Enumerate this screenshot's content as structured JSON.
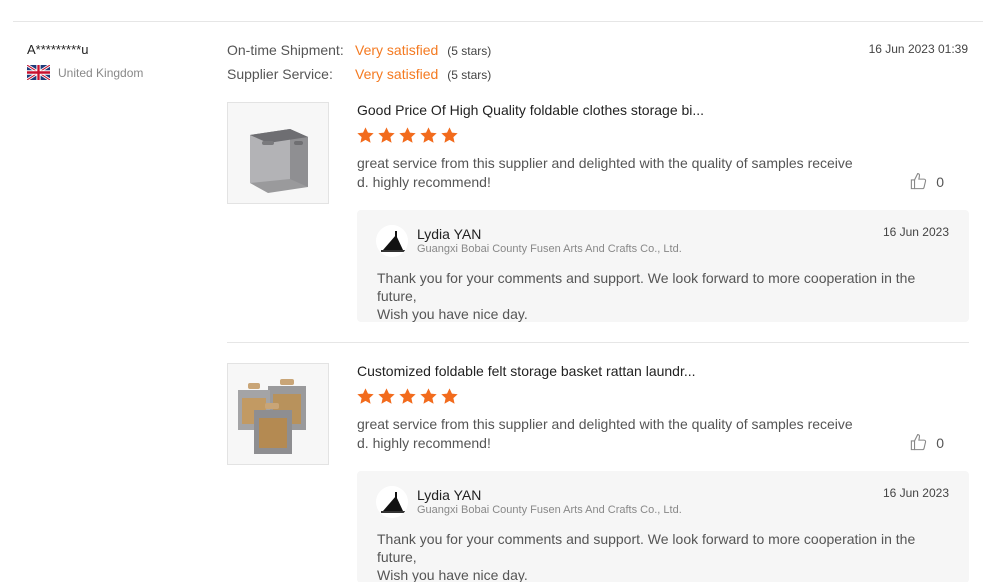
{
  "buyer": {
    "name": "A*********u",
    "country": "United Kingdom",
    "flag_icon": "uk-flag-icon"
  },
  "ratings": [
    {
      "label": "On-time Shipment:",
      "value": "Very satisfied",
      "note": "(5 stars)"
    },
    {
      "label": "Supplier Service:",
      "value": "Very satisfied",
      "note": "(5 stars)"
    }
  ],
  "review_date": "16 Jun 2023 01:39",
  "colors": {
    "accent": "#f47a21",
    "star": "#f26b1d",
    "reply_bg": "#f6f6f6"
  },
  "products": [
    {
      "title": "Good Price Of High Quality foldable clothes storage bi...",
      "stars": 5,
      "comment_line1": "great service from this supplier and delighted with the quality of samples receive",
      "comment_line2": "d. highly recommend!",
      "likes": "0",
      "image_icon": "felt-storage-box-image",
      "reply": {
        "name": "Lydia YAN",
        "company": "Guangxi Bobai County Fusen Arts And Crafts Co., Ltd.",
        "date": "16 Jun 2023",
        "text_line1": "Thank you for your comments and support. We look forward to more cooperation in the future,",
        "text_line2": "Wish you have  nice day."
      }
    },
    {
      "title": "Customized foldable felt storage basket rattan laundr...",
      "stars": 5,
      "comment_line1": "great service from this supplier and delighted with the quality of samples receive",
      "comment_line2": "d. highly recommend!",
      "likes": "0",
      "image_icon": "rattan-felt-baskets-image",
      "reply": {
        "name": "Lydia YAN",
        "company": "Guangxi Bobai County Fusen Arts And Crafts Co., Ltd.",
        "date": "16 Jun 2023",
        "text_line1": "Thank you for your comments and support. We look forward to more cooperation in the future,",
        "text_line2": "Wish you have  nice day."
      }
    }
  ]
}
